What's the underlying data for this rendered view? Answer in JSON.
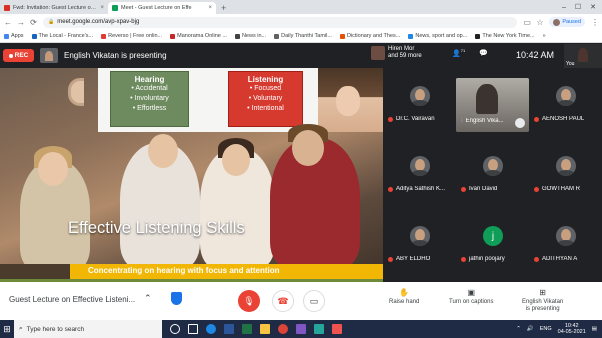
{
  "browser": {
    "tabs": [
      {
        "title": "Fwd: Invitation: Guest Lecture on Ef",
        "close": "×",
        "color": "#d93025",
        "active": false
      },
      {
        "title": "Meet - Guest Lecture on Effe",
        "close": "×",
        "color": "#0f9d58",
        "active": true
      }
    ],
    "new_tab": "+",
    "window_controls": [
      "–",
      "☐",
      "✕"
    ],
    "url": "meet.google.com/avp-xpav-bjg",
    "profile_status": "Paused",
    "bookmarks": [
      {
        "label": "Apps",
        "color": "#4285f4"
      },
      {
        "label": "The Local - France's...",
        "color": "#1565c0"
      },
      {
        "label": "Reverso | Free onlin...",
        "color": "#e53935"
      },
      {
        "label": "Manorama Online ...",
        "color": "#c62828"
      },
      {
        "label": "News in...",
        "color": "#424242"
      },
      {
        "label": "Daily Thanthi Tamil...",
        "color": "#616161"
      },
      {
        "label": "Dictionary and Thes...",
        "color": "#e65100"
      },
      {
        "label": "News, sport and op...",
        "color": "#1e88e5"
      },
      {
        "label": "The New York Time...",
        "color": "#212121"
      }
    ],
    "more_bookmarks": "»"
  },
  "meet": {
    "rec_label": "REC",
    "presenter_label": "English Vikatan is presenting",
    "others_label_line1": "Hiren Mor",
    "others_label_line2": "and 59 more",
    "participant_count": "71",
    "clock": "10:42 AM",
    "self_label": "You",
    "slide": {
      "hearing_title": "Hearing",
      "hearing_items": [
        "• Accidental",
        "• Involuntary",
        "• Effortless"
      ],
      "listening_title": "Listening",
      "listening_items": [
        "• Focused",
        "• Voluntary",
        "• Intentional"
      ],
      "title": "Effective Listening Skills",
      "subtitle": "Concentrating on hearing with focus and attention"
    },
    "participants": [
      {
        "name": "Dr.C. Vairavan",
        "muted": true
      },
      {
        "name": "English Vika...",
        "muted": false,
        "speaking": true
      },
      {
        "name": "AENOSH PAUL",
        "muted": true
      },
      {
        "name": "Aditya Sathish K...",
        "muted": true
      },
      {
        "name": "Ivan David",
        "muted": true
      },
      {
        "name": "GOWTHAM R",
        "muted": true
      },
      {
        "name": "ABY ELDHO",
        "muted": true
      },
      {
        "name": "jathin poojary",
        "muted": true,
        "initial": "j"
      },
      {
        "name": "ADITHYAN A",
        "muted": true
      }
    ],
    "meeting_title": "Guest Lecture on Effective Listeni...",
    "raise_hand": "Raise hand",
    "captions": "Turn on captions",
    "presenting_line1": "English Vikatan",
    "presenting_line2": "is presenting"
  },
  "taskbar": {
    "search_placeholder": "Type here to search",
    "lang": "ENG",
    "time": "10:42",
    "date": "04-05-2021"
  }
}
